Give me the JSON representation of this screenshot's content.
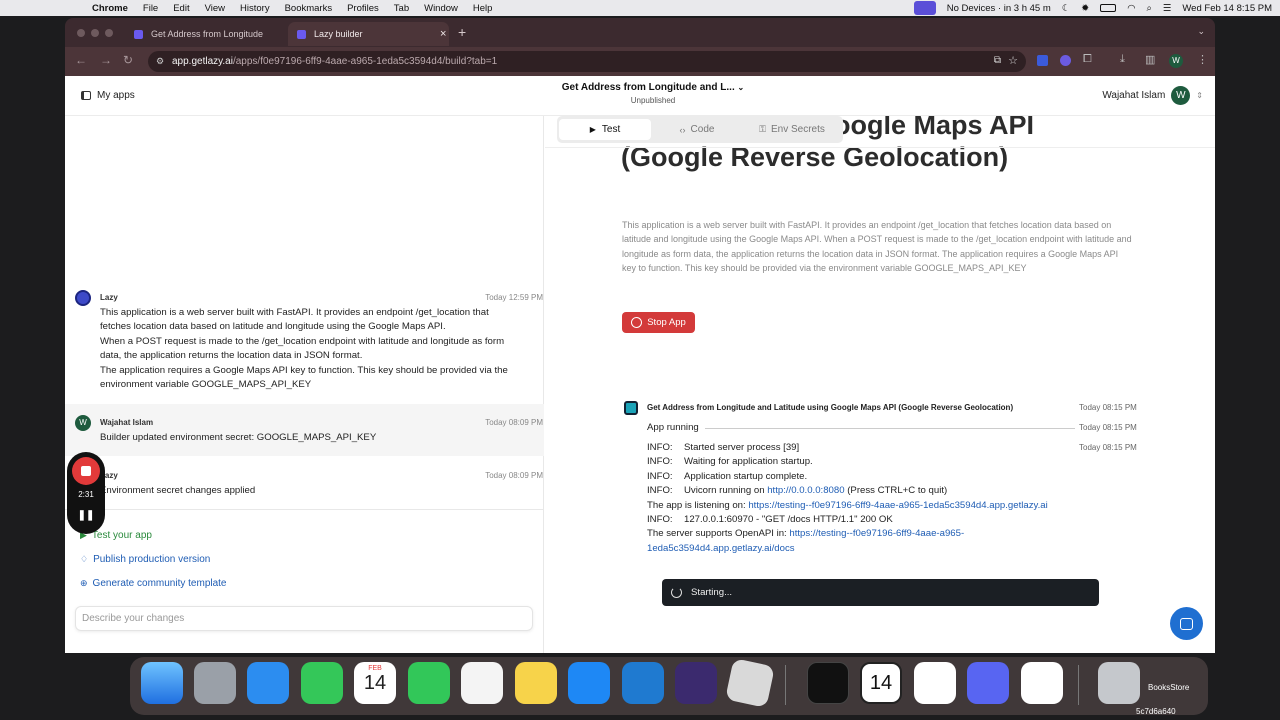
{
  "menubar": {
    "app": "Chrome",
    "items": [
      "File",
      "Edit",
      "View",
      "History",
      "Bookmarks",
      "Profiles",
      "Tab",
      "Window",
      "Help"
    ],
    "status_devices": "No Devices · in 3 h 45 m",
    "datetime": "Wed Feb 14  8:15 PM"
  },
  "browser": {
    "tabs": [
      {
        "title": "Get Address from Longitude"
      },
      {
        "title": "Lazy builder"
      }
    ],
    "url_host": "app.getlazy.ai",
    "url_path": "/apps/f0e97196-6ff9-4aae-a965-1eda5c3594d4/build?tab=1",
    "profile_initial": "W"
  },
  "header": {
    "my_apps": "My apps",
    "app_title": "Get Address from Longitude and L...",
    "app_status": "Unpublished",
    "user_name": "Wajahat Islam",
    "user_initial": "W"
  },
  "chat": {
    "messages": [
      {
        "author": "Lazy",
        "time": "Today 12:59 PM",
        "lines": [
          "This application is a web server built with FastAPI. It provides an endpoint /get_location that",
          "fetches location data based on latitude and longitude using the Google Maps API.",
          "When a POST request is made to the /get_location endpoint with latitude and longitude as form",
          "data, the application returns the location data in JSON format.",
          "The application requires a Google Maps API key to function. This key should be provided via the",
          "environment variable GOOGLE_MAPS_API_KEY"
        ]
      },
      {
        "author": "Wajahat Islam",
        "initial": "W",
        "time": "Today 08:09 PM",
        "lines": [
          "Builder updated environment secret: GOOGLE_MAPS_API_KEY"
        ]
      },
      {
        "author": "Lazy",
        "time": "Today 08:09 PM",
        "lines": [
          "Environment secret changes applied"
        ]
      }
    ],
    "actions": [
      "Test your app",
      "Publish production version",
      "Generate community template"
    ],
    "input_placeholder": "Describe your changes"
  },
  "recorder": {
    "time": "2:31"
  },
  "panel": {
    "tabs": [
      "Test",
      "Code",
      "Env Secrets"
    ],
    "title_line1": "Latitude using Google Maps API",
    "title_line2": "(Google Reverse Geolocation)",
    "description": "This application is a web server built with FastAPI. It provides an endpoint /get_location that fetches location data based on latitude and longitude using the Google Maps API. When a POST request is made to the /get_location endpoint with latitude and longitude as form data, the application returns the location data in JSON format. The application requires a Google Maps API key to function. This key should be provided via the environment variable GOOGLE_MAPS_API_KEY",
    "stop_button": "Stop App",
    "log": {
      "app_name": "Get Address from Longitude and Latitude using Google Maps API (Google Reverse Geolocation)",
      "header_time": "Today 08:15 PM",
      "running": "App running",
      "running_time": "Today 08:15 PM",
      "first_time": "Today 08:15 PM",
      "info1_label": "INFO:",
      "info1": "Started server process [39]",
      "info2_label": "INFO:",
      "info2": "Waiting for application startup.",
      "info3_label": "INFO:",
      "info3": "Application startup complete.",
      "info4_label": "INFO:",
      "info4_pre": "Uvicorn running on",
      "info4_link": "http://0.0.0.0:8080",
      "info4_post": "(Press CTRL+C to quit)",
      "listening_pre": "The app is listening on:",
      "listening_link": "https://testing--f0e97196-6ff9-4aae-a965-1eda5c3594d4.app.getlazy.ai",
      "info5_label": "INFO:",
      "info5": "127.0.0.1:60970 - \"GET /docs HTTP/1.1\" 200 OK",
      "openapi_pre": "The server supports OpenAPI in:",
      "openapi_link1": "https://testing--f0e97196-6ff9-4aae-a965-",
      "openapi_link2": "1eda5c3594d4.app.getlazy.ai/docs"
    },
    "starting": "Starting..."
  },
  "dock": {
    "calendar_month": "FEB",
    "calendar_day": "14",
    "books_label": "BooksStore",
    "hash_label": "5c7d6a640"
  },
  "colors": {
    "stop_red": "#d33a3a",
    "brand_green": "#1e5b3e",
    "link": "#1f5db4"
  }
}
